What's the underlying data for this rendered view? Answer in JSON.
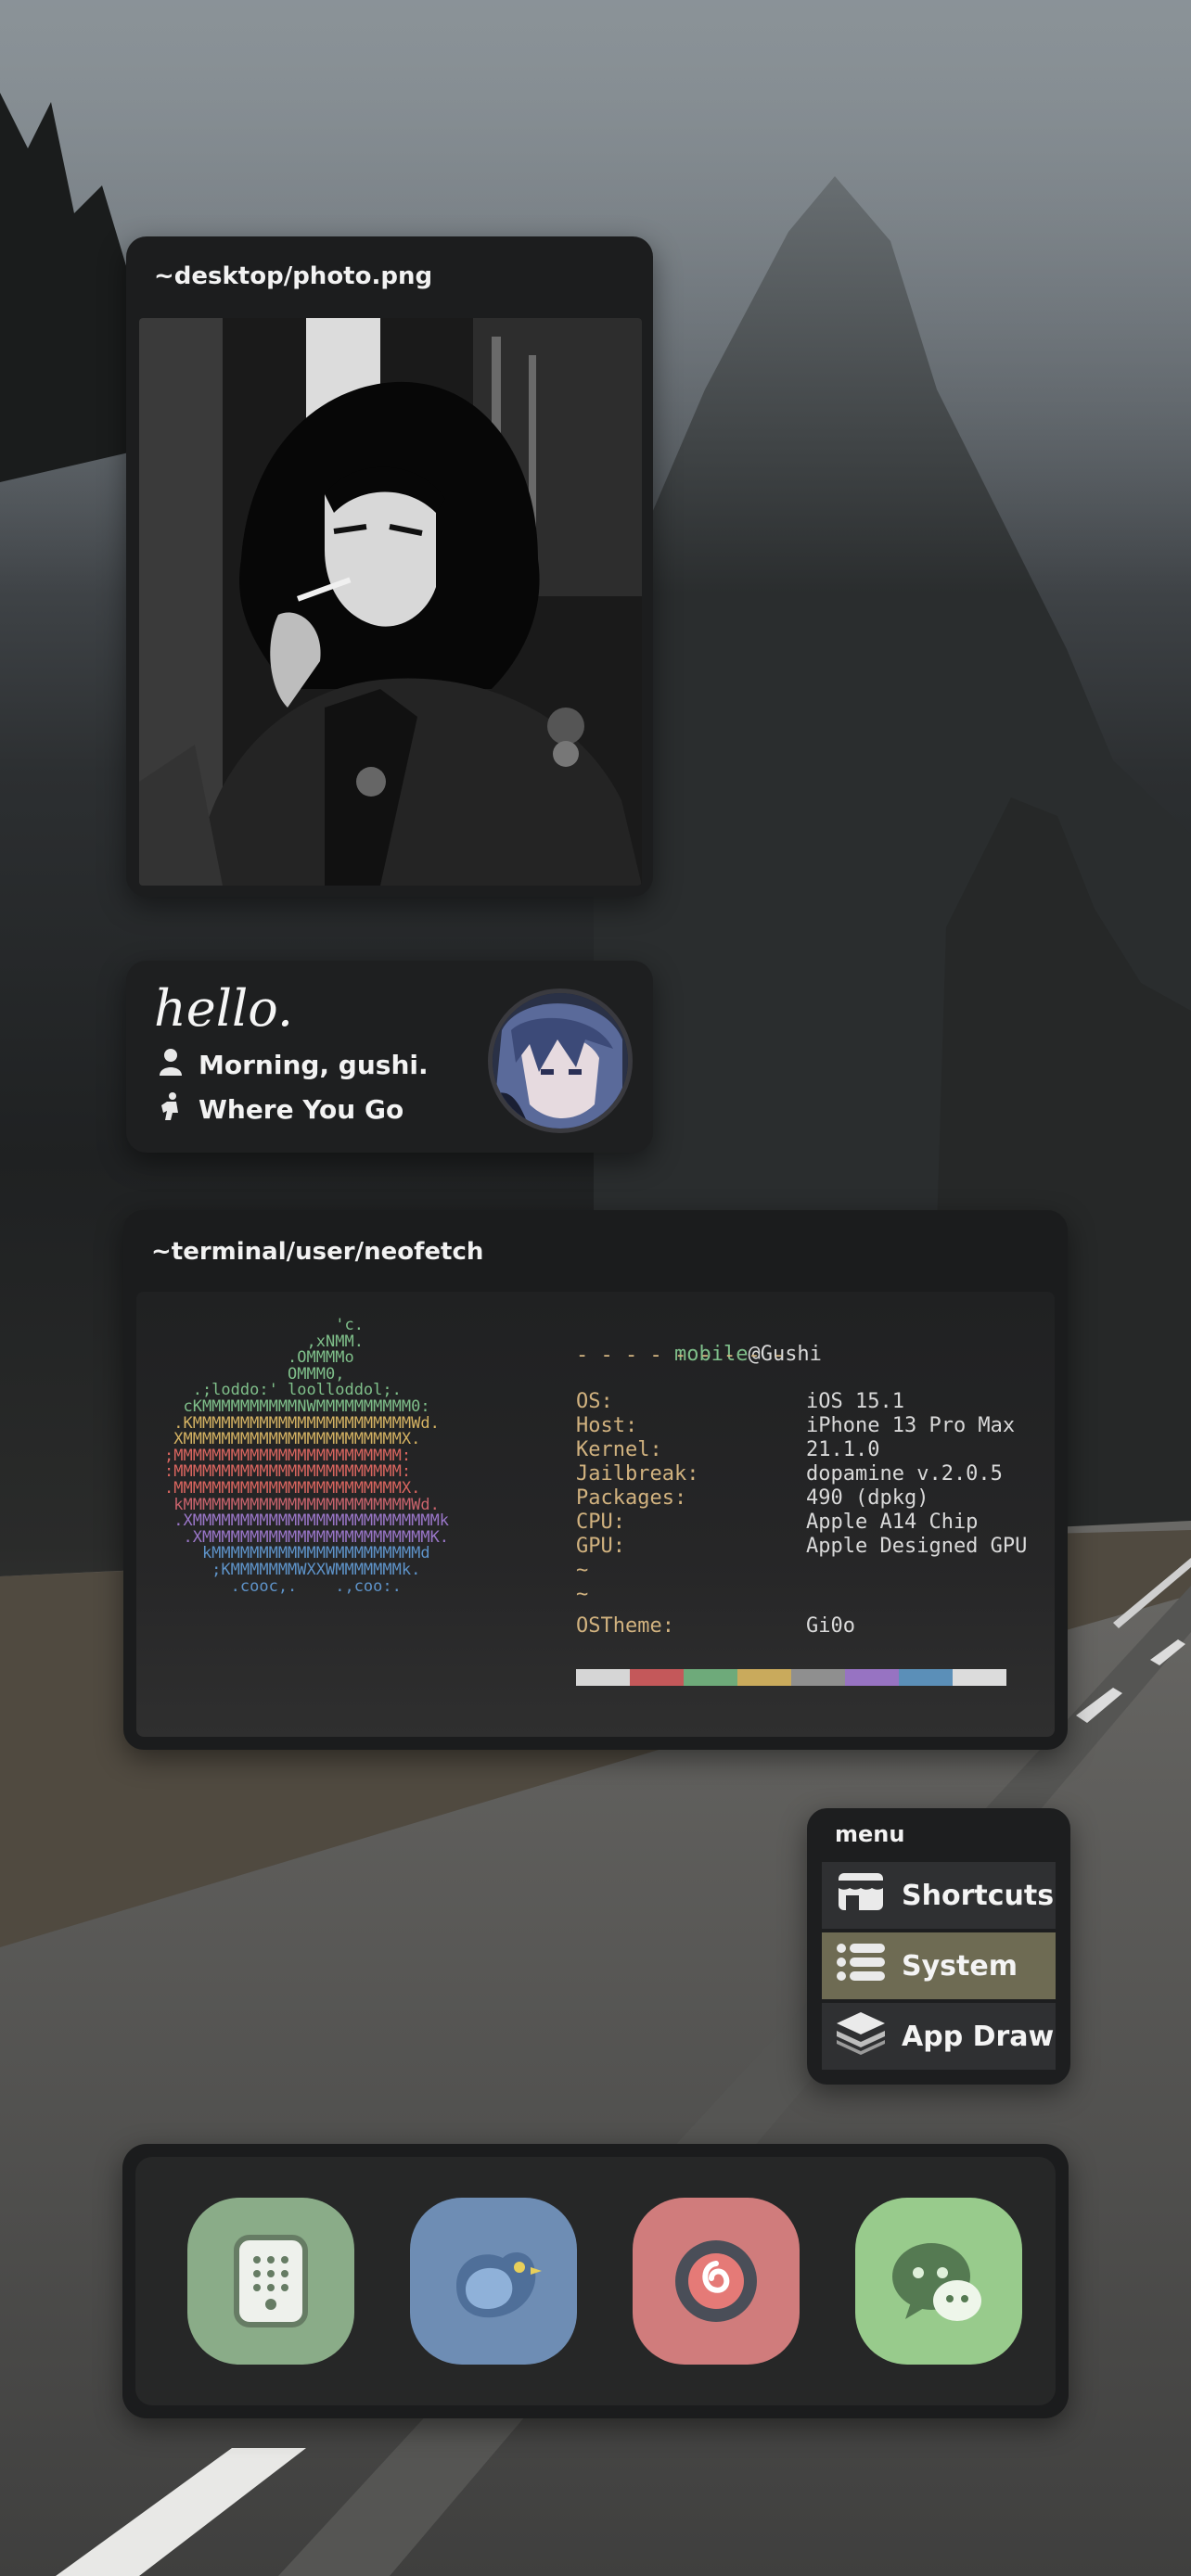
{
  "wallpaper": {
    "description_icon": "misty-mountain-road-wallpaper"
  },
  "photo_widget": {
    "title": "~desktop/photo.png",
    "image_icon": "manga-portrait-image"
  },
  "hello_widget": {
    "greeting": "hello.",
    "line1": "Morning, gushi.",
    "line1_icon": "person-icon",
    "line2": "Where You Go",
    "line2_icon": "walker-icon",
    "avatar_icon": "anime-avatar-image"
  },
  "terminal_widget": {
    "title": "~terminal/user/neofetch",
    "user": "mobile",
    "at_host": "@Gushi",
    "separator": "- - - - - - - - -",
    "fields": [
      {
        "key": "OS:",
        "value": "iOS 15.1"
      },
      {
        "key": "Host:",
        "value": "iPhone 13 Pro Max"
      },
      {
        "key": "Kernel:",
        "value": "21.1.0"
      },
      {
        "key": "Jailbreak:",
        "value": "dopamine v.2.0.5"
      },
      {
        "key": "Packages:",
        "value": "490 (dpkg)"
      },
      {
        "key": "CPU:",
        "value": "Apple A14 Chip"
      },
      {
        "key": "GPU:",
        "value": "Apple Designed GPU"
      },
      {
        "key": "~",
        "value": ""
      },
      {
        "key": "~",
        "value": ""
      },
      {
        "key": "OSTheme:",
        "value": "Gi0o"
      }
    ],
    "ascii_lines": [
      {
        "text": "                  'c.",
        "color": "#7fbf8a"
      },
      {
        "text": "               ,xNMM.",
        "color": "#7fbf8a"
      },
      {
        "text": "             .OMMMMo",
        "color": "#7fbf8a"
      },
      {
        "text": "             OMMM0,",
        "color": "#7fbf8a"
      },
      {
        "text": "   .;loddo:' loolloddol;.",
        "color": "#7fbf8a"
      },
      {
        "text": "  cKMMMMMMMMMMNWMMMMMMMMMM0:",
        "color": "#7fbf8a"
      },
      {
        "text": " .KMMMMMMMMMMMMMMMMMMMMMMMWd.",
        "color": "#d4b262"
      },
      {
        "text": " XMMMMMMMMMMMMMMMMMMMMMMMX.",
        "color": "#d4b262"
      },
      {
        "text": ";MMMMMMMMMMMMMMMMMMMMMMMM:",
        "color": "#d9655f"
      },
      {
        "text": ":MMMMMMMMMMMMMMMMMMMMMMMM:",
        "color": "#d9655f"
      },
      {
        "text": ".MMMMMMMMMMMMMMMMMMMMMMMMX.",
        "color": "#d9655f"
      },
      {
        "text": " kMMMMMMMMMMMMMMMMMMMMMMMMWd.",
        "color": "#c9636c"
      },
      {
        "text": " .XMMMMMMMMMMMMMMMMMMMMMMMMMMk",
        "color": "#9a76c8"
      },
      {
        "text": "  .XMMMMMMMMMMMMMMMMMMMMMMMMK.",
        "color": "#9a76c8"
      },
      {
        "text": "    kMMMMMMMMMMMMMMMMMMMMMMd",
        "color": "#5e93c9"
      },
      {
        "text": "     ;KMMMMMMMWXXWMMMMMMMk.",
        "color": "#5e93c9"
      },
      {
        "text": "       .cooc,.    .,coo:.",
        "color": "#5e93c9"
      }
    ],
    "palette": [
      "#d6d6d6",
      "#c4585a",
      "#6eaa7a",
      "#c9aa5c",
      "#8f8f8f",
      "#9773c2",
      "#5b8fb8",
      "#dcdcdc"
    ]
  },
  "menu_widget": {
    "title": "menu",
    "items": [
      {
        "label": "Shortcuts",
        "icon": "store-icon"
      },
      {
        "label": "System",
        "icon": "list-icon"
      },
      {
        "label": "App Draw",
        "icon": "layers-icon"
      }
    ]
  },
  "dock": {
    "apps": [
      {
        "name": "dialer",
        "icon": "keypad-phone-icon",
        "color": "#8aac88"
      },
      {
        "name": "bird",
        "icon": "bird-icon",
        "color": "#6e8db4"
      },
      {
        "name": "music",
        "icon": "netease-music-icon",
        "color": "#d07c7c"
      },
      {
        "name": "wechat",
        "icon": "wechat-icon",
        "color": "#98cb8c"
      }
    ]
  }
}
